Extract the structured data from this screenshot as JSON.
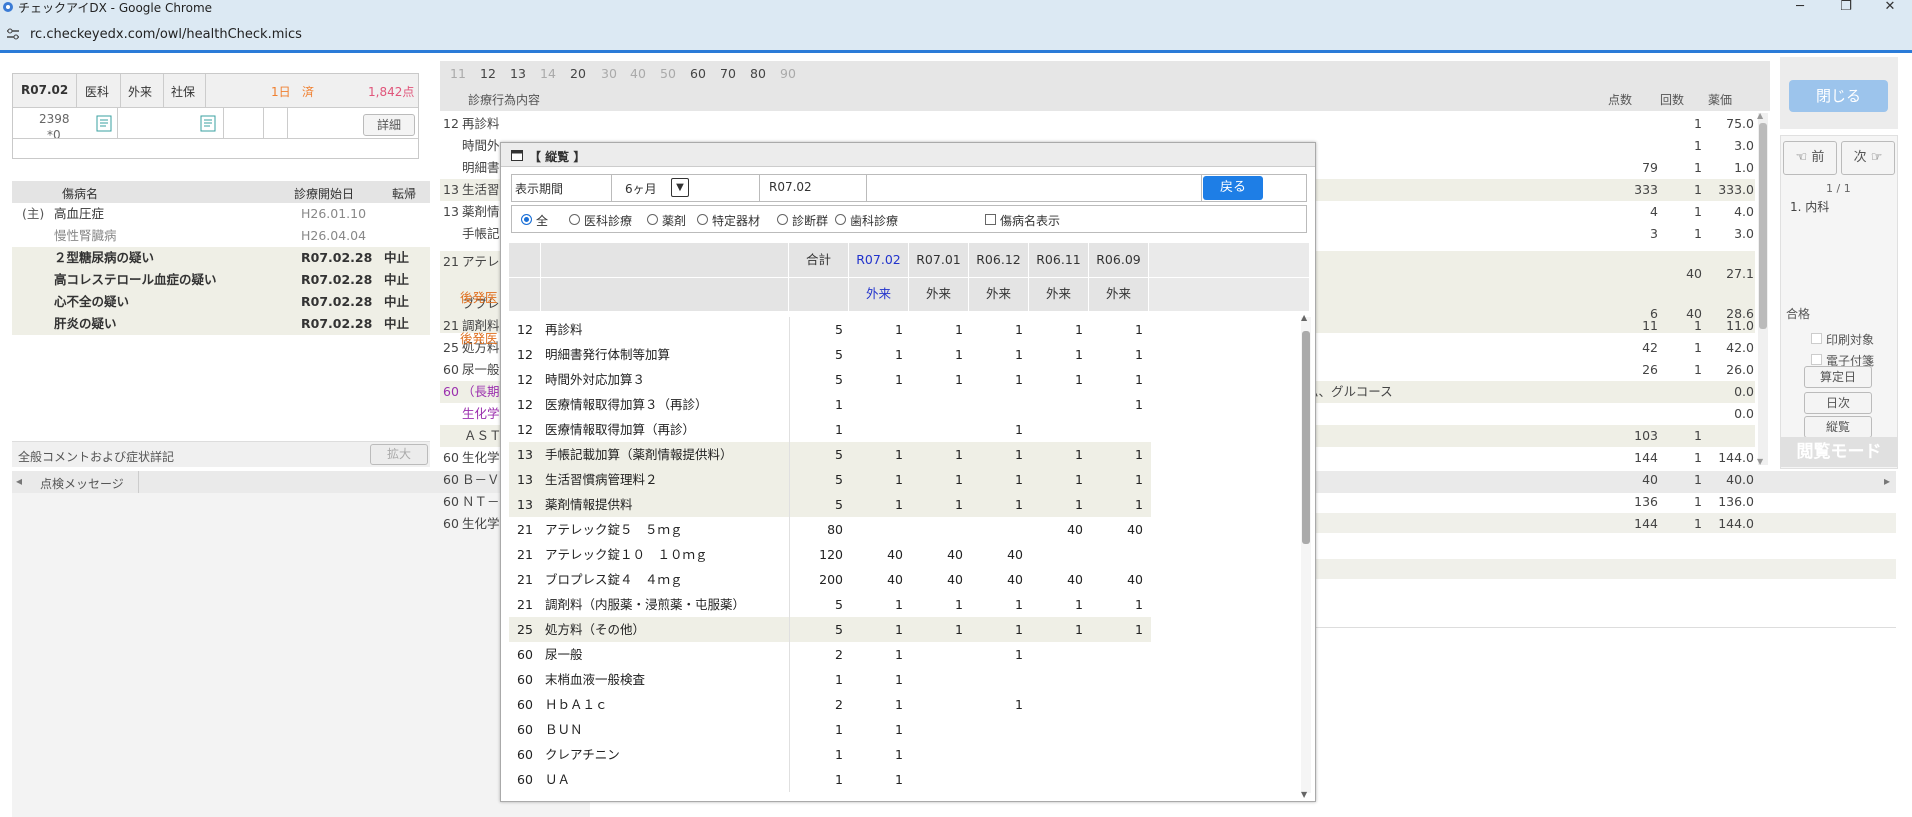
{
  "browser": {
    "title": "チェックアイDX - Google Chrome",
    "url": "rc.checkeyedx.com/owl/healthCheck.mics",
    "min": "─",
    "max": "❐",
    "close": "✕"
  },
  "patient": {
    "ym": "R07.02",
    "kind": "医科",
    "type": "外来",
    "ins": "社保",
    "days": "1日",
    "done": "済",
    "points": "1,842点",
    "id": "2398",
    "sub": "*0",
    "detail": "詳細"
  },
  "disease": {
    "headers": [
      "傷病名",
      "診療開始日",
      "転帰"
    ],
    "rows": [
      {
        "pfx": "(主)",
        "name": "高血圧症",
        "date": "H26.01.10",
        "out": "",
        "bold": false,
        "grey": false
      },
      {
        "pfx": "",
        "name": "慢性腎臓病",
        "date": "H26.04.04",
        "out": "",
        "bold": false,
        "grey": true
      },
      {
        "pfx": "",
        "name": "２型糖尿病の疑い",
        "date": "R07.02.28",
        "out": "中止",
        "bold": true,
        "grey": false
      },
      {
        "pfx": "",
        "name": "高コレステロール血症の疑い",
        "date": "R07.02.28",
        "out": "中止",
        "bold": true,
        "grey": false
      },
      {
        "pfx": "",
        "name": "心不全の疑い",
        "date": "R07.02.28",
        "out": "中止",
        "bold": true,
        "grey": false
      },
      {
        "pfx": "",
        "name": "肝炎の疑い",
        "date": "R07.02.28",
        "out": "中止",
        "bold": true,
        "grey": false
      }
    ]
  },
  "comment": {
    "label": "全般コメントおよび症状詳記",
    "btn": "拡大"
  },
  "check": {
    "tab": "点検メッセージ"
  },
  "main": {
    "tabs": [
      "11",
      "12",
      "13",
      "14",
      "20",
      "30",
      "40",
      "50",
      "60",
      "70",
      "80",
      "90"
    ],
    "tabs_active": [
      false,
      true,
      true,
      false,
      true,
      false,
      false,
      false,
      true,
      true,
      true,
      false
    ],
    "header": {
      "content": "診療行為内容",
      "pts": "点数",
      "cnt": "回数",
      "price": "薬価"
    },
    "rows": [
      {
        "code": "12",
        "name": "再診料",
        "pts": "",
        "cnt": "1",
        "price": "75.0"
      },
      {
        "code": "",
        "name": "時間外",
        "pts": "",
        "cnt": "1",
        "price": "3.0"
      },
      {
        "code": "",
        "name": "明細書",
        "pts": "79",
        "cnt": "1",
        "price": "1.0"
      },
      {
        "code": "13",
        "name": "生活習",
        "pts": "333",
        "cnt": "1",
        "price": "333.0"
      },
      {
        "code": "13",
        "name": "薬剤情",
        "pts": "4",
        "cnt": "1",
        "price": "4.0"
      },
      {
        "code": "",
        "name": "手帳記",
        "pts": "3",
        "cnt": "1",
        "price": "3.0"
      },
      {
        "code": "21",
        "name": "アテレ",
        "pts": "",
        "cnt": "40",
        "price": "27.1"
      },
      {
        "code": "",
        "name": "ブプレ",
        "pts": "6",
        "cnt": "40",
        "price": "28.6"
      },
      {
        "code": "21",
        "name": "調剤料",
        "pts": "11",
        "cnt": "1",
        "price": "11.0"
      },
      {
        "code": "25",
        "name": "処方料",
        "pts": "42",
        "cnt": "1",
        "price": "42.0"
      },
      {
        "code": "60",
        "name": "尿一般",
        "pts": "26",
        "cnt": "1",
        "price": "26.0"
      },
      {
        "code": "60",
        "name": "（長期",
        "pts": "",
        "cnt": "",
        "price": "0.0"
      },
      {
        "code": "",
        "name": "生化学",
        "pts": "",
        "cnt": "",
        "price": "0.0"
      },
      {
        "code": "",
        "name": "ＡＳＴ",
        "pts": "103",
        "cnt": "1",
        "price": ""
      },
      {
        "code": "60",
        "name": "生化学",
        "pts": "144",
        "cnt": "1",
        "price": "144.0"
      },
      {
        "code": "60",
        "name": "Ｂ－Ｖ",
        "pts": "40",
        "cnt": "1",
        "price": "40.0"
      },
      {
        "code": "60",
        "name": "ＮＴ－",
        "pts": "136",
        "cnt": "1",
        "price": "136.0"
      },
      {
        "code": "60",
        "name": "生化学",
        "pts": "144",
        "cnt": "1",
        "price": "144.0"
      }
    ],
    "generic1": "後発医",
    "generic2": "後発医",
    "ast_tail": "ム、グルコース"
  },
  "side": {
    "close": "閉じる",
    "prev": "☜ 前",
    "next": "次 ☞",
    "page": "1 / 1",
    "dept": "1. 内科",
    "pass": "合格",
    "print": "印刷対象",
    "elec": "電子付箋",
    "calc": "算定日",
    "daily": "日次",
    "vert": "縦覧",
    "mode": "閲覧モード"
  },
  "modal": {
    "title": "【 縦覧 】",
    "period_label": "表示期間",
    "period_value": "6ヶ月",
    "ym": "R07.02",
    "back": "戻る",
    "filters": [
      "全",
      "医科診療",
      "薬剤",
      "特定器材",
      "診断群",
      "歯科診療"
    ],
    "show_disease": "傷病名表示",
    "col_total": "合計",
    "months": [
      "R07.02",
      "R07.01",
      "R06.12",
      "R06.11",
      "R06.09"
    ],
    "visit": [
      "外来",
      "外来",
      "外来",
      "外来",
      "外来"
    ],
    "rows": [
      {
        "code": "12",
        "name": "再診料",
        "total": "5",
        "v": [
          "1",
          "1",
          "1",
          "1",
          "1"
        ],
        "alt": false
      },
      {
        "code": "12",
        "name": "明細書発行体制等加算",
        "total": "5",
        "v": [
          "1",
          "1",
          "1",
          "1",
          "1"
        ],
        "alt": false
      },
      {
        "code": "12",
        "name": "時間外対応加算３",
        "total": "5",
        "v": [
          "1",
          "1",
          "1",
          "1",
          "1"
        ],
        "alt": false
      },
      {
        "code": "12",
        "name": "医療情報取得加算３（再診）",
        "total": "1",
        "v": [
          "",
          "",
          "",
          "",
          "1"
        ],
        "alt": false
      },
      {
        "code": "12",
        "name": "医療情報取得加算（再診）",
        "total": "1",
        "v": [
          "",
          "",
          "1",
          "",
          ""
        ],
        "alt": false
      },
      {
        "code": "13",
        "name": "手帳記載加算（薬剤情報提供料）",
        "total": "5",
        "v": [
          "1",
          "1",
          "1",
          "1",
          "1"
        ],
        "alt": true
      },
      {
        "code": "13",
        "name": "生活習慣病管理料２",
        "total": "5",
        "v": [
          "1",
          "1",
          "1",
          "1",
          "1"
        ],
        "alt": true
      },
      {
        "code": "13",
        "name": "薬剤情報提供料",
        "total": "5",
        "v": [
          "1",
          "1",
          "1",
          "1",
          "1"
        ],
        "alt": true
      },
      {
        "code": "21",
        "name": "アテレック錠５　５ｍｇ",
        "total": "80",
        "v": [
          "",
          "",
          "",
          "40",
          "40"
        ],
        "alt": false
      },
      {
        "code": "21",
        "name": "アテレック錠１０　１０ｍｇ",
        "total": "120",
        "v": [
          "40",
          "40",
          "40",
          "",
          ""
        ],
        "alt": false
      },
      {
        "code": "21",
        "name": "ブロプレス錠４　４ｍｇ",
        "total": "200",
        "v": [
          "40",
          "40",
          "40",
          "40",
          "40"
        ],
        "alt": false
      },
      {
        "code": "21",
        "name": "調剤料（内服薬・浸煎薬・屯服薬）",
        "total": "5",
        "v": [
          "1",
          "1",
          "1",
          "1",
          "1"
        ],
        "alt": false
      },
      {
        "code": "25",
        "name": "処方料（その他）",
        "total": "5",
        "v": [
          "1",
          "1",
          "1",
          "1",
          "1"
        ],
        "alt": true
      },
      {
        "code": "60",
        "name": "尿一般",
        "total": "2",
        "v": [
          "1",
          "",
          "1",
          "",
          ""
        ],
        "alt": false
      },
      {
        "code": "60",
        "name": "末梢血液一般検査",
        "total": "1",
        "v": [
          "1",
          "",
          "",
          "",
          ""
        ],
        "alt": false
      },
      {
        "code": "60",
        "name": "ＨｂＡ１ｃ",
        "total": "2",
        "v": [
          "1",
          "",
          "1",
          "",
          ""
        ],
        "alt": false
      },
      {
        "code": "60",
        "name": "ＢＵＮ",
        "total": "1",
        "v": [
          "1",
          "",
          "",
          "",
          ""
        ],
        "alt": false
      },
      {
        "code": "60",
        "name": "クレアチニン",
        "total": "1",
        "v": [
          "1",
          "",
          "",
          "",
          ""
        ],
        "alt": false
      },
      {
        "code": "60",
        "name": "ＵＡ",
        "total": "1",
        "v": [
          "1",
          "",
          "",
          "",
          ""
        ],
        "alt": false
      }
    ]
  }
}
